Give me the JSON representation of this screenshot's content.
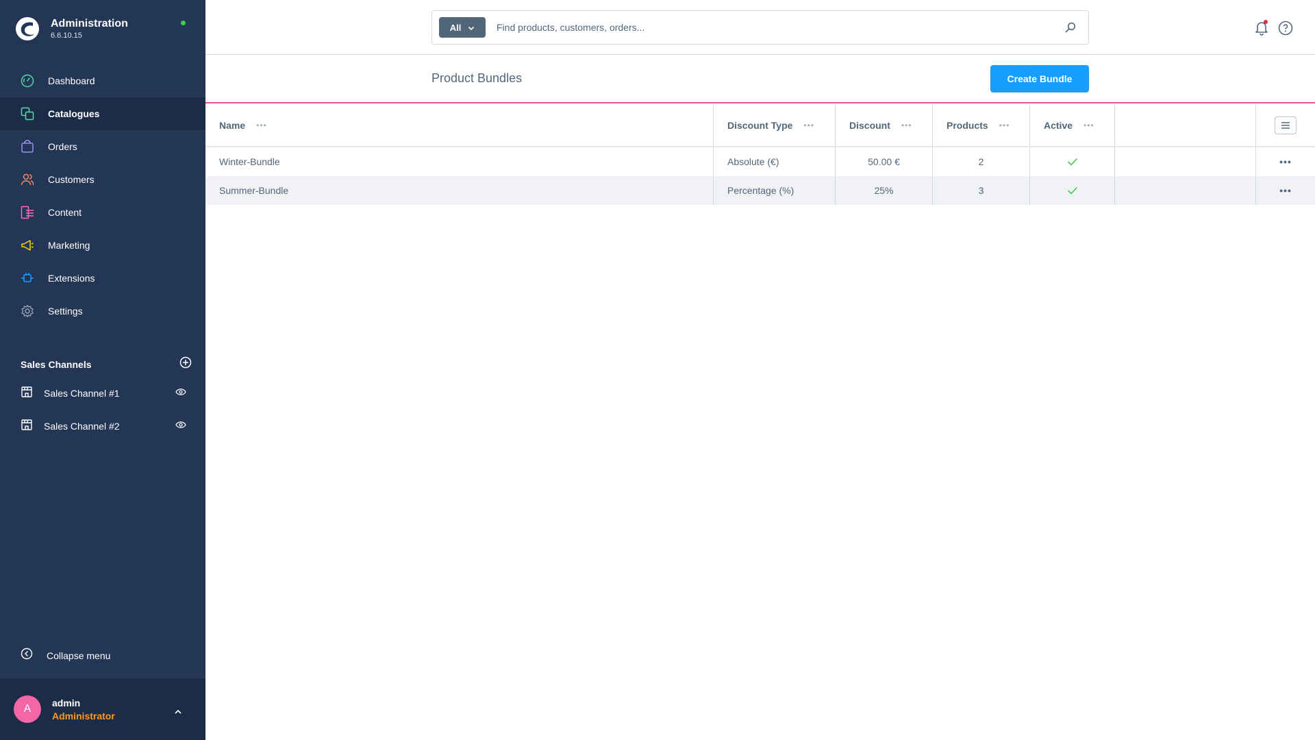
{
  "app": {
    "title": "Administration",
    "version": "6.6.10.15"
  },
  "sidebar": {
    "items": [
      {
        "label": "Dashboard",
        "icon": "dashboard-icon",
        "color": "#57d9a3"
      },
      {
        "label": "Catalogues",
        "icon": "catalogues-icon",
        "color": "#57d9a3",
        "active": true
      },
      {
        "label": "Orders",
        "icon": "orders-icon",
        "color": "#a092f0"
      },
      {
        "label": "Customers",
        "icon": "customers-icon",
        "color": "#f88962"
      },
      {
        "label": "Content",
        "icon": "content-icon",
        "color": "#ff68b4"
      },
      {
        "label": "Marketing",
        "icon": "marketing-icon",
        "color": "#ffd700"
      },
      {
        "label": "Extensions",
        "icon": "extensions-icon",
        "color": "#189eff"
      },
      {
        "label": "Settings",
        "icon": "settings-icon",
        "color": "#9aa8b5"
      }
    ],
    "sales_channels": {
      "title": "Sales Channels",
      "items": [
        {
          "label": "Sales Channel #1"
        },
        {
          "label": "Sales Channel #2"
        }
      ]
    },
    "collapse_label": "Collapse menu",
    "user": {
      "initial": "A",
      "name": "admin",
      "role": "Administrator"
    }
  },
  "search": {
    "type_label": "All",
    "placeholder": "Find products, customers, orders..."
  },
  "page": {
    "title": "Product Bundles",
    "create_button": "Create Bundle"
  },
  "grid": {
    "columns": [
      "Name",
      "Discount Type",
      "Discount",
      "Products",
      "Active"
    ],
    "rows": [
      {
        "name": "Winter-Bundle",
        "discount_type": "Absolute (€)",
        "discount": "50.00 €",
        "products": "2",
        "active": true
      },
      {
        "name": "Summer-Bundle",
        "discount_type": "Percentage (%)",
        "discount": "25%",
        "products": "3",
        "active": true
      }
    ]
  },
  "colors": {
    "sidebar_bg": "#233655",
    "accent": "#189eff",
    "header_border": "#f04da0",
    "active_check": "#37d046"
  }
}
